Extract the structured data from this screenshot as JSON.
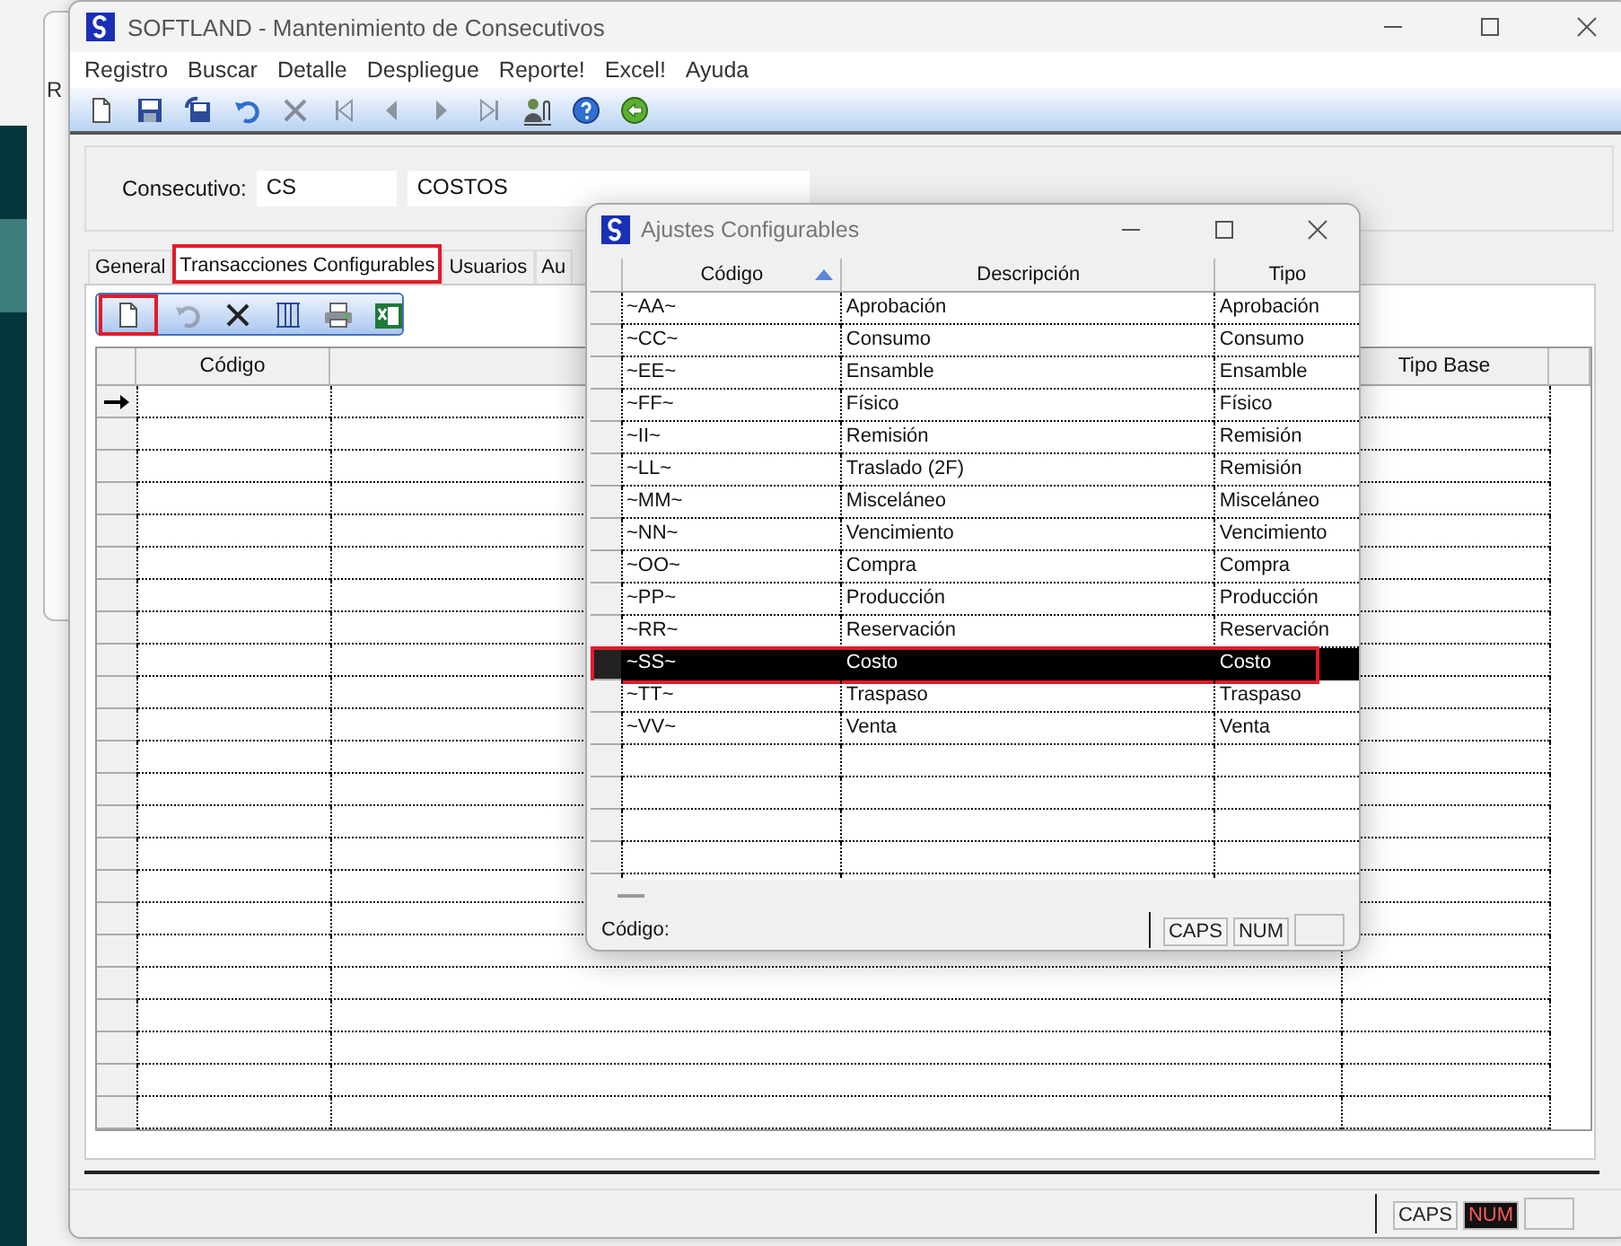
{
  "background_window": {
    "menu_fragment": "R"
  },
  "main_window": {
    "title": "SOFTLAND - Mantenimiento de Consecutivos",
    "menu": [
      "Registro",
      "Buscar",
      "Detalle",
      "Despliegue",
      "Reporte!",
      "Excel!",
      "Ayuda"
    ],
    "toolbar": [
      {
        "kind": "new",
        "disabled": false
      },
      {
        "kind": "save",
        "disabled": false
      },
      {
        "kind": "save-all",
        "disabled": false
      },
      {
        "kind": "undo",
        "disabled": false
      },
      {
        "kind": "delete",
        "disabled": true
      },
      {
        "kind": "first",
        "disabled": true
      },
      {
        "kind": "previous",
        "disabled": true
      },
      {
        "kind": "next",
        "disabled": true
      },
      {
        "kind": "last",
        "disabled": true
      },
      {
        "kind": "attach",
        "disabled": false
      },
      {
        "kind": "help",
        "disabled": false
      },
      {
        "kind": "exit",
        "disabled": false
      }
    ],
    "header": {
      "label": "Consecutivo:",
      "code": "CS",
      "description": "COSTOS"
    },
    "tabs": [
      {
        "label": "General",
        "selected": false,
        "highlighted": false
      },
      {
        "label": "Transacciones Configurables",
        "selected": true,
        "highlighted": true
      },
      {
        "label": "Usuarios",
        "selected": false,
        "highlighted": false
      },
      {
        "label": "Au",
        "selected": false,
        "highlighted": false
      }
    ],
    "tab_toolbar": [
      {
        "kind": "new",
        "disabled": false,
        "highlighted": true
      },
      {
        "kind": "undo",
        "disabled": true,
        "highlighted": false
      },
      {
        "kind": "delete",
        "disabled": false,
        "highlighted": false
      },
      {
        "kind": "columns",
        "disabled": false,
        "highlighted": false
      },
      {
        "kind": "print",
        "disabled": false,
        "highlighted": false
      },
      {
        "kind": "excel",
        "disabled": false,
        "highlighted": false
      }
    ],
    "grid": {
      "columns": [
        "Código",
        "Tipo Base"
      ]
    },
    "status_bar": {
      "indicators": [
        {
          "label": "CAPS",
          "on": false
        },
        {
          "label": "NUM",
          "on": true
        }
      ]
    }
  },
  "dialog": {
    "title": "Ajustes Configurables",
    "columns": [
      {
        "label": "Código",
        "sorted_ascending": true
      },
      {
        "label": "Descripción",
        "sorted_ascending": false
      },
      {
        "label": "Tipo",
        "sorted_ascending": false
      }
    ],
    "rows": [
      {
        "code": "~AA~",
        "description": "Aprobación",
        "type": "Aprobación",
        "selected": false
      },
      {
        "code": "~CC~",
        "description": "Consumo",
        "type": "Consumo",
        "selected": false
      },
      {
        "code": "~EE~",
        "description": "Ensamble",
        "type": "Ensamble",
        "selected": false
      },
      {
        "code": "~FF~",
        "description": "Físico",
        "type": "Físico",
        "selected": false
      },
      {
        "code": "~II~",
        "description": "Remisión",
        "type": "Remisión",
        "selected": false
      },
      {
        "code": "~LL~",
        "description": "Traslado (2F)",
        "type": "Remisión",
        "selected": false
      },
      {
        "code": "~MM~",
        "description": "Misceláneo",
        "type": "Misceláneo",
        "selected": false
      },
      {
        "code": "~NN~",
        "description": "Vencimiento",
        "type": "Vencimiento",
        "selected": false
      },
      {
        "code": "~OO~",
        "description": "Compra",
        "type": "Compra",
        "selected": false
      },
      {
        "code": "~PP~",
        "description": "Producción",
        "type": "Producción",
        "selected": false
      },
      {
        "code": "~RR~",
        "description": "Reservación",
        "type": "Reservación",
        "selected": false
      },
      {
        "code": "~SS~",
        "description": "Costo",
        "type": "Costo",
        "selected": true
      },
      {
        "code": "~TT~",
        "description": "Traspaso",
        "type": "Traspaso",
        "selected": false
      },
      {
        "code": "~VV~",
        "description": "Venta",
        "type": "Venta",
        "selected": false
      }
    ],
    "status": {
      "label": "Código:",
      "indicators": [
        {
          "label": "CAPS",
          "on": false
        },
        {
          "label": "NUM",
          "on": false
        }
      ]
    }
  }
}
